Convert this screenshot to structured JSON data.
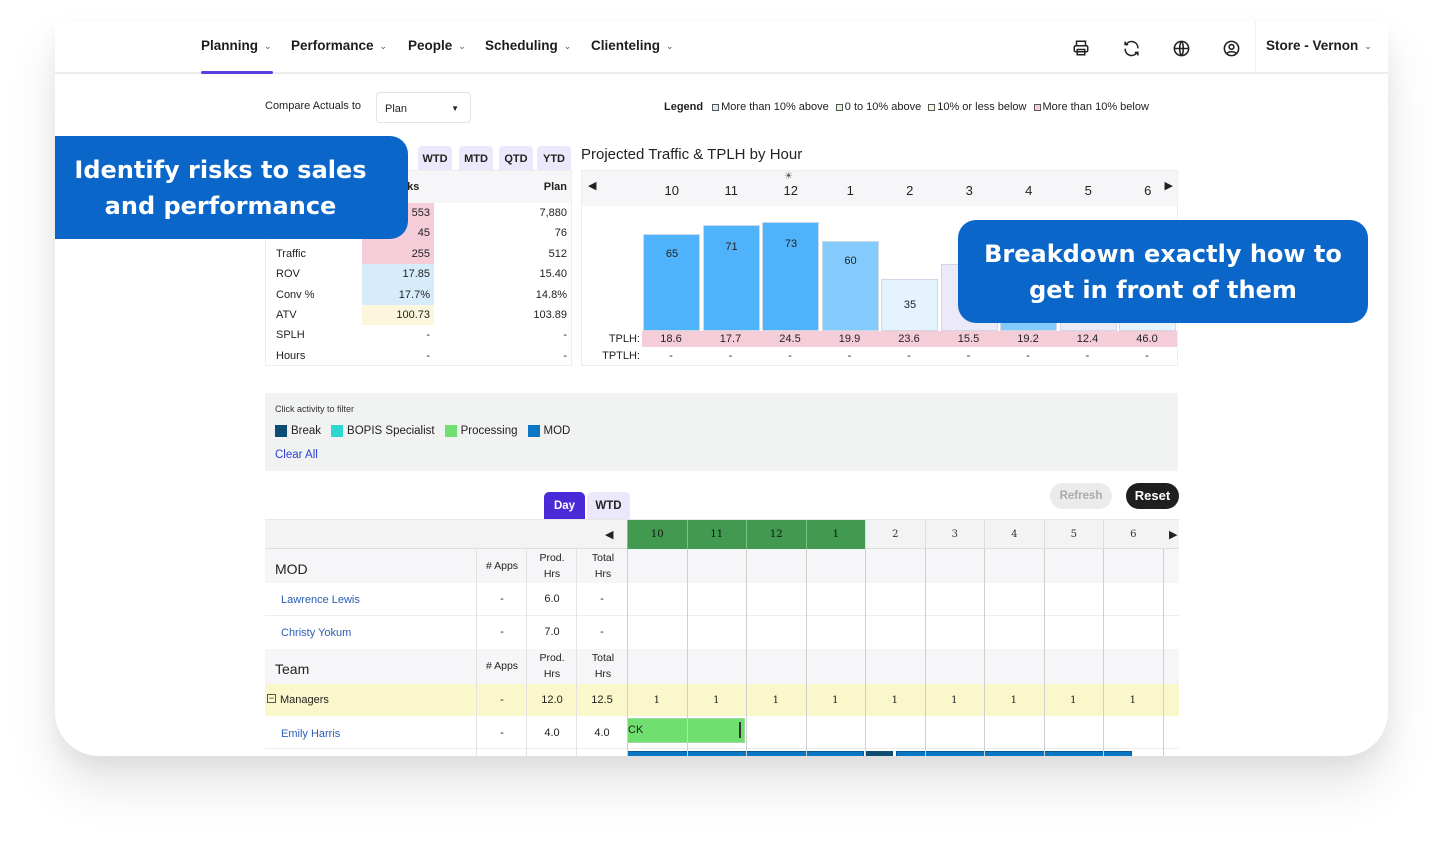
{
  "nav": {
    "items": [
      {
        "label": "Planning",
        "active": true
      },
      {
        "label": "Performance"
      },
      {
        "label": "People"
      },
      {
        "label": "Scheduling"
      },
      {
        "label": "Clienteling"
      }
    ],
    "icons": [
      "print-icon",
      "refresh-icon",
      "globe-icon",
      "user-icon"
    ],
    "store_label": "Store - Vernon"
  },
  "compare": {
    "label": "Compare Actuals to",
    "selected": "Plan"
  },
  "legend": {
    "title": "Legend",
    "items": [
      {
        "label": "More than 10% above",
        "color": "#d6ecfb"
      },
      {
        "label": "0 to 10% above",
        "color": "#e3f3e0"
      },
      {
        "label": "10% or less below",
        "color": "#fcf7dc"
      },
      {
        "label": "More than 10% below",
        "color": "#f4cdd8"
      }
    ]
  },
  "period_tabs": [
    "WTD",
    "MTD",
    "QTD",
    "YTD"
  ],
  "metrics": {
    "col_actual": "Risks",
    "col_plan": "Plan",
    "rows": [
      {
        "label": "",
        "actual": "553",
        "plan": "7,880",
        "status": "below_more"
      },
      {
        "label": "",
        "actual": "45",
        "plan": "76",
        "status": "below_more"
      },
      {
        "label": "Traffic",
        "actual": "255",
        "plan": "512",
        "status": "below_more"
      },
      {
        "label": "ROV",
        "actual": "17.85",
        "plan": "15.40",
        "status": "above_more"
      },
      {
        "label": "Conv %",
        "actual": "17.7%",
        "plan": "14.8%",
        "status": "above_more"
      },
      {
        "label": "ATV",
        "actual": "100.73",
        "plan": "103.89",
        "status": "below_less"
      },
      {
        "label": "SPLH",
        "actual": "-",
        "plan": "-",
        "status": "none"
      },
      {
        "label": "Hours",
        "actual": "-",
        "plan": "-",
        "status": "none"
      }
    ]
  },
  "chart_data": {
    "type": "bar",
    "title": "Projected Traffic & TPLH by Hour",
    "categories": [
      "10",
      "11",
      "12",
      "1",
      "2",
      "3",
      "4",
      "5",
      "6"
    ],
    "values": [
      65,
      71,
      73,
      60,
      35,
      45,
      50,
      45,
      43
    ],
    "visible_labels": [
      "65",
      "71",
      "73",
      "60",
      "35",
      "",
      "",
      "",
      ""
    ],
    "bar_colors": [
      "#4fb3fb",
      "#4fb3fb",
      "#4fb3fb",
      "#83cbfd",
      "#e5f3fe",
      "#ece9f9",
      "#83cbfd",
      "#ece9f9",
      "#e5f3fe"
    ],
    "current_hour_marker": "12",
    "ylim": [
      0,
      80
    ],
    "tplh_label": "TPLH:",
    "tplh": [
      "18.6",
      "17.7",
      "24.5",
      "19.9",
      "23.6",
      "15.5",
      "19.2",
      "12.4",
      "46.0"
    ],
    "tptlh_label": "TPTLH:",
    "tptlh": [
      "-",
      "-",
      "-",
      "-",
      "-",
      "-",
      "-",
      "-",
      "-"
    ]
  },
  "activity": {
    "title": "Click activity to filter",
    "items": [
      {
        "label": "Break",
        "color": "#0d4c73"
      },
      {
        "label": "BOPIS Specialist",
        "color": "#2dd6cf"
      },
      {
        "label": "Processing",
        "color": "#6fe070"
      },
      {
        "label": "MOD",
        "color": "#0b76c4"
      }
    ],
    "clear_label": "Clear All"
  },
  "schedule": {
    "tabs": [
      {
        "label": "Day",
        "active": true
      },
      {
        "label": "WTD"
      }
    ],
    "refresh_label": "Refresh",
    "reset_label": "Reset",
    "hours": [
      "10",
      "11",
      "12",
      "1",
      "2",
      "3",
      "4",
      "5",
      "6"
    ],
    "hours_active": [
      true,
      true,
      true,
      true,
      false,
      false,
      false,
      false,
      false
    ],
    "col_apps": "# Apps",
    "col_prod": "Prod. Hrs",
    "col_prod_1": "Prod.",
    "col_prod_2": "Hrs",
    "col_total_1": "Total",
    "col_total_2": "Hrs",
    "mod_section": {
      "title": "MOD",
      "people": [
        {
          "name": "Lawrence Lewis",
          "apps": "-",
          "prod": "6.0",
          "total": "-"
        },
        {
          "name": "Christy Yokum",
          "apps": "-",
          "prod": "7.0",
          "total": "-"
        }
      ]
    },
    "team_section": {
      "title": "Team",
      "group": {
        "name": "Managers",
        "apps": "-",
        "prod": "12.0",
        "total": "12.5",
        "counts": [
          "1",
          "1",
          "1",
          "1",
          "1",
          "1",
          "1",
          "1",
          "1"
        ]
      },
      "people": [
        {
          "name": "Emily Harris",
          "apps": "-",
          "prod": "4.0",
          "total": "4.0",
          "shift_label": "CK"
        }
      ]
    }
  },
  "callouts": {
    "left": "Identify risks to sales and performance",
    "left_line1": "Identify risks to sales",
    "left_line2": "and performance",
    "right_line1": "Breakdown exactly how to",
    "right_line2": "get in front of them"
  }
}
